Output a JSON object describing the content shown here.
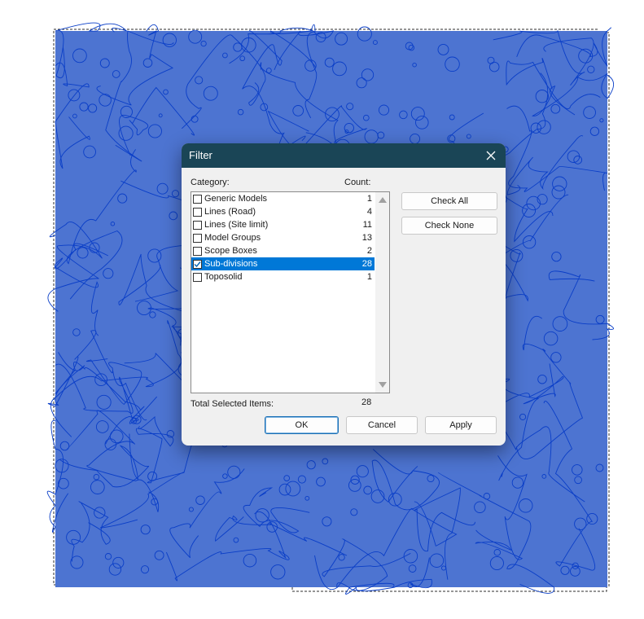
{
  "dialog": {
    "title": "Filter",
    "category_label": "Category:",
    "count_label": "Count:",
    "categories": [
      {
        "name": "Generic Models",
        "count": "1",
        "checked": false,
        "selected": false
      },
      {
        "name": "Lines (Road)",
        "count": "4",
        "checked": false,
        "selected": false
      },
      {
        "name": "Lines (Site limit)",
        "count": "11",
        "checked": false,
        "selected": false
      },
      {
        "name": "Model Groups",
        "count": "13",
        "checked": false,
        "selected": false
      },
      {
        "name": "Scope Boxes",
        "count": "2",
        "checked": false,
        "selected": false
      },
      {
        "name": "Sub-divisions",
        "count": "28",
        "checked": true,
        "selected": true
      },
      {
        "name": "Toposolid",
        "count": "1",
        "checked": false,
        "selected": false
      }
    ],
    "total_label": "Total Selected Items:",
    "total_value": "28",
    "buttons": {
      "check_all": "Check All",
      "check_none": "Check None",
      "ok": "OK",
      "cancel": "Cancel",
      "apply": "Apply"
    }
  },
  "colors": {
    "titlebar": "#1a4556",
    "selection": "#0078d7",
    "drawing_fill": "#4d74d1",
    "drawing_lines": "#0a3ec7"
  }
}
